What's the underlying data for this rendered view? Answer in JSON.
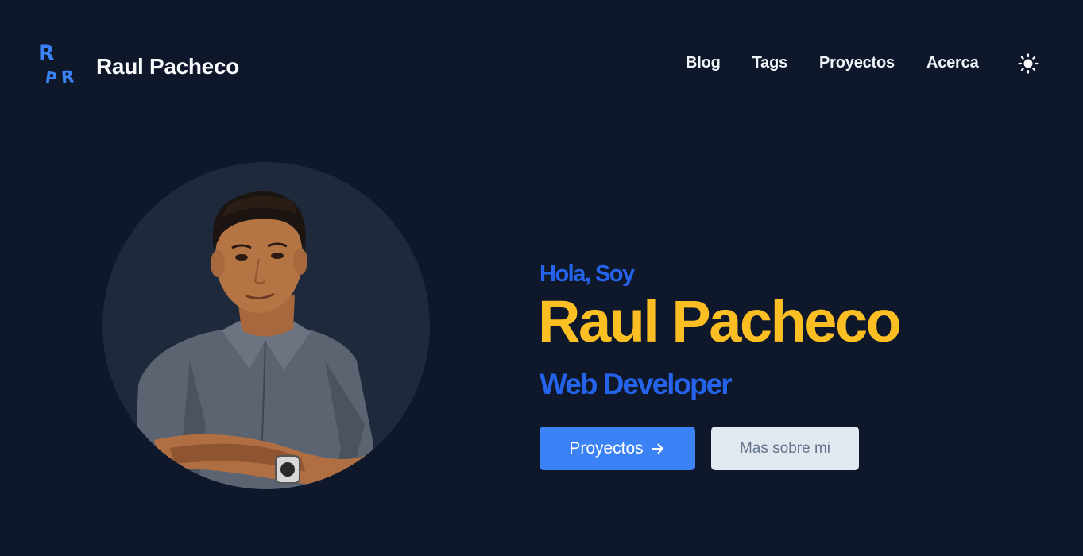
{
  "header": {
    "logo_letters": [
      "R",
      "P",
      "R"
    ],
    "site_title": "Raul Pacheco",
    "nav": [
      {
        "label": "Blog"
      },
      {
        "label": "Tags"
      },
      {
        "label": "Proyectos"
      },
      {
        "label": "Acerca"
      }
    ],
    "theme_icon": "sun-icon"
  },
  "hero": {
    "avatar_alt": "avatar-photo",
    "greeting": "Hola, Soy",
    "name": "Raul Pacheco",
    "role": "Web Developer",
    "primary_button": "Proyectos",
    "primary_button_icon": "arrow-right-icon",
    "secondary_button": "Mas sobre mi"
  },
  "colors": {
    "background": "#0f172a",
    "accent_blue": "#2563eb",
    "button_blue": "#3b82f6",
    "name_yellow": "#fbbf24",
    "avatar_bg": "#1e293b",
    "secondary_button_bg": "#e2e8f0"
  }
}
